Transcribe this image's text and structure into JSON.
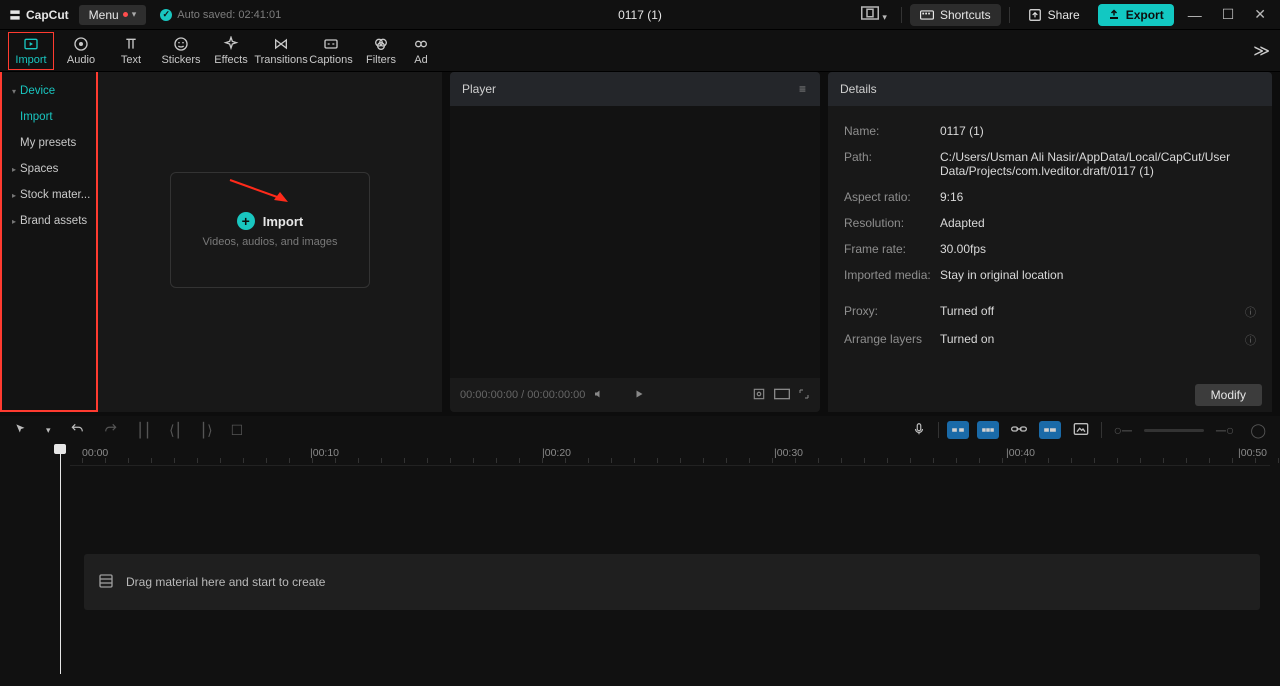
{
  "titlebar": {
    "app_name": "CapCut",
    "menu_label": "Menu",
    "autosave_label": "Auto saved: 02:41:01",
    "project_title": "0117 (1)",
    "shortcuts": "Shortcuts",
    "share": "Share",
    "export": "Export"
  },
  "tabs": {
    "import": "Import",
    "audio": "Audio",
    "text": "Text",
    "stickers": "Stickers",
    "effects": "Effects",
    "transitions": "Transitions",
    "captions": "Captions",
    "filters": "Filters",
    "ad": "Ad"
  },
  "sidebar": {
    "device": "Device",
    "import": "Import",
    "mypresets": "My presets",
    "spaces": "Spaces",
    "stock": "Stock mater...",
    "brand": "Brand assets"
  },
  "importbox": {
    "title": "Import",
    "subtitle": "Videos, audios, and images"
  },
  "player": {
    "title": "Player",
    "time": "00:00:00:00 / 00:00:00:00"
  },
  "details": {
    "title": "Details",
    "rows": {
      "name_l": "Name:",
      "name_v": "0117 (1)",
      "path_l": "Path:",
      "path_v": "C:/Users/Usman Ali Nasir/AppData/Local/CapCut/User Data/Projects/com.lveditor.draft/0117 (1)",
      "aspect_l": "Aspect ratio:",
      "aspect_v": "9:16",
      "res_l": "Resolution:",
      "res_v": "Adapted",
      "fps_l": "Frame rate:",
      "fps_v": "30.00fps",
      "media_l": "Imported media:",
      "media_v": "Stay in original location",
      "proxy_l": "Proxy:",
      "proxy_v": "Turned off",
      "layers_l": "Arrange layers",
      "layers_v": "Turned on"
    },
    "modify": "Modify"
  },
  "timeline": {
    "ticks": [
      "00:00",
      "|00:10",
      "|00:20",
      "|00:30",
      "|00:40",
      "|00:50"
    ],
    "drop_hint": "Drag material here and start to create"
  }
}
